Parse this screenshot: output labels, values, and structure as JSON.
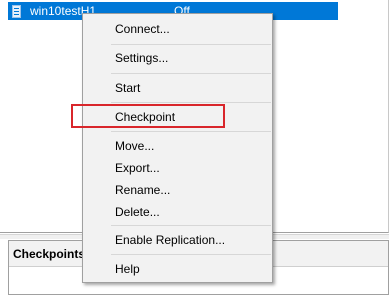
{
  "vm_list": {
    "selected_vm": {
      "name": "win10testH1",
      "state": "Off"
    }
  },
  "checkpoints_panel": {
    "title": "Checkpoints"
  },
  "context_menu": {
    "items": [
      {
        "label": "Connect..."
      },
      {
        "label": "Settings..."
      },
      {
        "label": "Start"
      },
      {
        "label": "Checkpoint"
      },
      {
        "label": "Move..."
      },
      {
        "label": "Export..."
      },
      {
        "label": "Rename..."
      },
      {
        "label": "Delete..."
      },
      {
        "label": "Enable Replication..."
      },
      {
        "label": "Help"
      }
    ],
    "highlighted_item": "Checkpoint",
    "highlight_color": "#d9262b"
  },
  "colors": {
    "selection": "#0078d7",
    "menu_background": "#f2f2f2"
  },
  "icons": {
    "vm": "vm-icon"
  }
}
